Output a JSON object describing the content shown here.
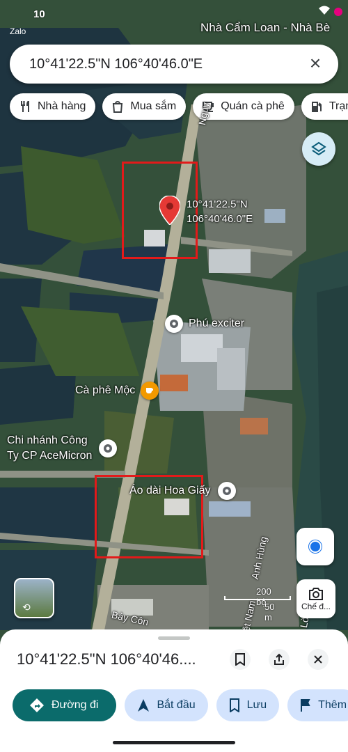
{
  "status_bar": {
    "time": "10",
    "app_label": "Zalo"
  },
  "map": {
    "top_label": "Nhà Cẩm Loan - Nhà Bè",
    "pin_coords_line1": "10°41'22.5\"N",
    "pin_coords_line2": "106°40'46.0\"E",
    "pois": [
      {
        "name": "Phú exciter"
      },
      {
        "name": "Cà phê Mộc"
      },
      {
        "name_line1": "Chi nhánh Công",
        "name_line2": "Ty CP AceMicron"
      },
      {
        "name": "Áo dài Hoa Giấy"
      }
    ],
    "roads": {
      "nguy": "Nguy",
      "anh_hung": "Anh Hùng",
      "nam": "ệt Nam",
      "bay_con": "Bảy Côn",
      "lo": "Lò"
    },
    "scale": {
      "feet": "200 bộ",
      "meters": "50 m"
    },
    "lens_label": "Chế đ..."
  },
  "search": {
    "query": "10°41'22.5\"N 106°40'46.0\"E"
  },
  "chips": [
    {
      "label": "Nhà hàng",
      "icon": "restaurant-icon"
    },
    {
      "label": "Mua sắm",
      "icon": "shopping-bag-icon"
    },
    {
      "label": "Quán cà phê",
      "icon": "coffee-icon"
    },
    {
      "label": "Trạm",
      "icon": "gas-station-icon"
    }
  ],
  "sheet": {
    "title": "10°41'22.5\"N 106°40'46....",
    "actions": [
      {
        "label": "Đường đi",
        "icon": "directions-icon"
      },
      {
        "label": "Bắt đầu",
        "icon": "navigation-icon"
      },
      {
        "label": "Lưu",
        "icon": "bookmark-icon"
      },
      {
        "label": "Thêm",
        "icon": "flag-icon"
      }
    ]
  },
  "colors": {
    "water": "#1e3440",
    "vegetation": "#3d5a2e",
    "highlight_box": "#e21a1a",
    "pin": "#e53935",
    "primary_action": "#0b6b6b"
  }
}
